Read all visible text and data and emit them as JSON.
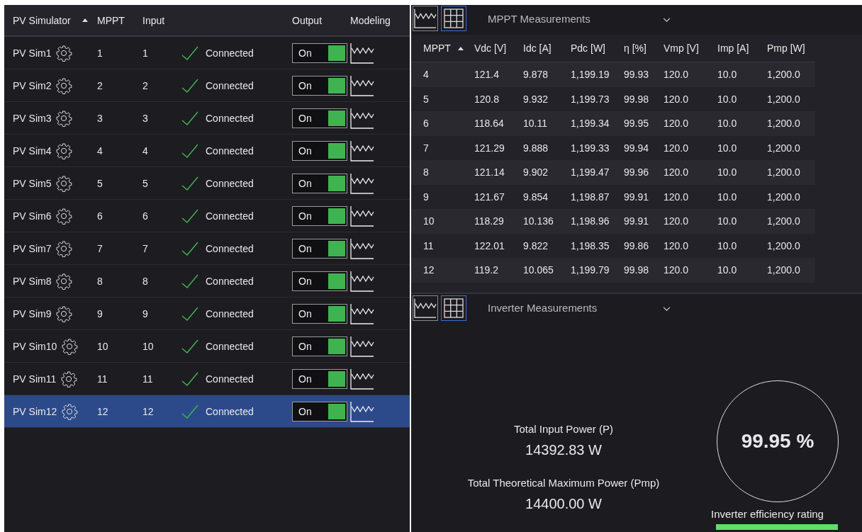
{
  "simulators": {
    "columns": [
      {
        "kind": "text",
        "label": "PV Simulator",
        "sorted": true
      },
      {
        "kind": "text",
        "label": "MPPT",
        "sorted": false
      },
      {
        "kind": "text",
        "label": "Input",
        "sorted": false
      },
      {
        "kind": "blank"
      },
      {
        "kind": "text",
        "label": "Output",
        "sorted": false
      },
      {
        "kind": "text",
        "label": "Modeling",
        "sorted": false
      }
    ],
    "rows": [
      {
        "name": "PV Sim1",
        "mppt": "1",
        "input": "1",
        "status": "Connected",
        "output": {
          "label": "On",
          "on": true
        },
        "selected": false
      },
      {
        "name": "PV Sim2",
        "mppt": "2",
        "input": "2",
        "status": "Connected",
        "output": {
          "label": "On",
          "on": true
        },
        "selected": false
      },
      {
        "name": "PV Sim3",
        "mppt": "3",
        "input": "3",
        "status": "Connected",
        "output": {
          "label": "On",
          "on": true
        },
        "selected": false
      },
      {
        "name": "PV Sim4",
        "mppt": "4",
        "input": "4",
        "status": "Connected",
        "output": {
          "label": "On",
          "on": true
        },
        "selected": false
      },
      {
        "name": "PV Sim5",
        "mppt": "5",
        "input": "5",
        "status": "Connected",
        "output": {
          "label": "On",
          "on": true
        },
        "selected": false
      },
      {
        "name": "PV Sim6",
        "mppt": "6",
        "input": "6",
        "status": "Connected",
        "output": {
          "label": "On",
          "on": true
        },
        "selected": false
      },
      {
        "name": "PV Sim7",
        "mppt": "7",
        "input": "7",
        "status": "Connected",
        "output": {
          "label": "On",
          "on": true
        },
        "selected": false
      },
      {
        "name": "PV Sim8",
        "mppt": "8",
        "input": "8",
        "status": "Connected",
        "output": {
          "label": "On",
          "on": true
        },
        "selected": false
      },
      {
        "name": "PV Sim9",
        "mppt": "9",
        "input": "9",
        "status": "Connected",
        "output": {
          "label": "On",
          "on": true
        },
        "selected": false
      },
      {
        "name": "PV Sim10",
        "mppt": "10",
        "input": "10",
        "status": "Connected",
        "output": {
          "label": "On",
          "on": true
        },
        "selected": false
      },
      {
        "name": "PV Sim11",
        "mppt": "11",
        "input": "11",
        "status": "Connected",
        "output": {
          "label": "On",
          "on": true
        },
        "selected": false
      },
      {
        "name": "PV Sim12",
        "mppt": "12",
        "input": "12",
        "status": "Connected",
        "output": {
          "label": "On",
          "on": true
        },
        "selected": true
      }
    ]
  },
  "mppt_panel": {
    "views": [
      {
        "kind": "chart",
        "selected": false
      },
      {
        "kind": "grid",
        "selected": true
      }
    ],
    "dropdown": "MPPT Measurements",
    "columns": [
      {
        "label": "MPPT",
        "sorted": true
      },
      {
        "label": "Vdc [V]",
        "sorted": false
      },
      {
        "label": "Idc [A]",
        "sorted": false
      },
      {
        "label": "Pdc [W]",
        "sorted": false
      },
      {
        "label": "η [%]",
        "sorted": false
      },
      {
        "label": "Vmp [V]",
        "sorted": false
      },
      {
        "label": "Imp [A]",
        "sorted": false
      },
      {
        "label": "Pmp [W]",
        "sorted": false
      }
    ],
    "rows": [
      [
        "4",
        "121.4",
        "9.878",
        "1,199.19",
        "99.93",
        "120.0",
        "10.0",
        "1,200.0"
      ],
      [
        "5",
        "120.8",
        "9.932",
        "1,199.73",
        "99.98",
        "120.0",
        "10.0",
        "1,200.0"
      ],
      [
        "6",
        "118.64",
        "10.11",
        "1,199.34",
        "99.95",
        "120.0",
        "10.0",
        "1,200.0"
      ],
      [
        "7",
        "121.29",
        "9.888",
        "1,199.33",
        "99.94",
        "120.0",
        "10.0",
        "1,200.0"
      ],
      [
        "8",
        "121.14",
        "9.902",
        "1,199.47",
        "99.96",
        "120.0",
        "10.0",
        "1,200.0"
      ],
      [
        "9",
        "121.67",
        "9.854",
        "1,198.87",
        "99.91",
        "120.0",
        "10.0",
        "1,200.0"
      ],
      [
        "10",
        "118.29",
        "10.136",
        "1,198.96",
        "99.91",
        "120.0",
        "10.0",
        "1,200.0"
      ],
      [
        "11",
        "122.01",
        "9.822",
        "1,198.35",
        "99.86",
        "120.0",
        "10.0",
        "1,200.0"
      ],
      [
        "12",
        "119.2",
        "10.065",
        "1,199.79",
        "99.98",
        "120.0",
        "10.0",
        "1,200.0"
      ]
    ]
  },
  "inverter_panel": {
    "views": [
      {
        "kind": "chart",
        "selected": false
      },
      {
        "kind": "grid",
        "selected": true
      }
    ],
    "dropdown": "Inverter Measurements",
    "metrics": [
      {
        "label": "Total Input Power (P)",
        "value": "14392.83 W"
      },
      {
        "label": "Total Theoretical Maximum Power (Pmp)",
        "value": "14400.00 W"
      }
    ],
    "efficiency": {
      "value": "99.95 %",
      "label": "Inverter efficiency rating"
    }
  }
}
